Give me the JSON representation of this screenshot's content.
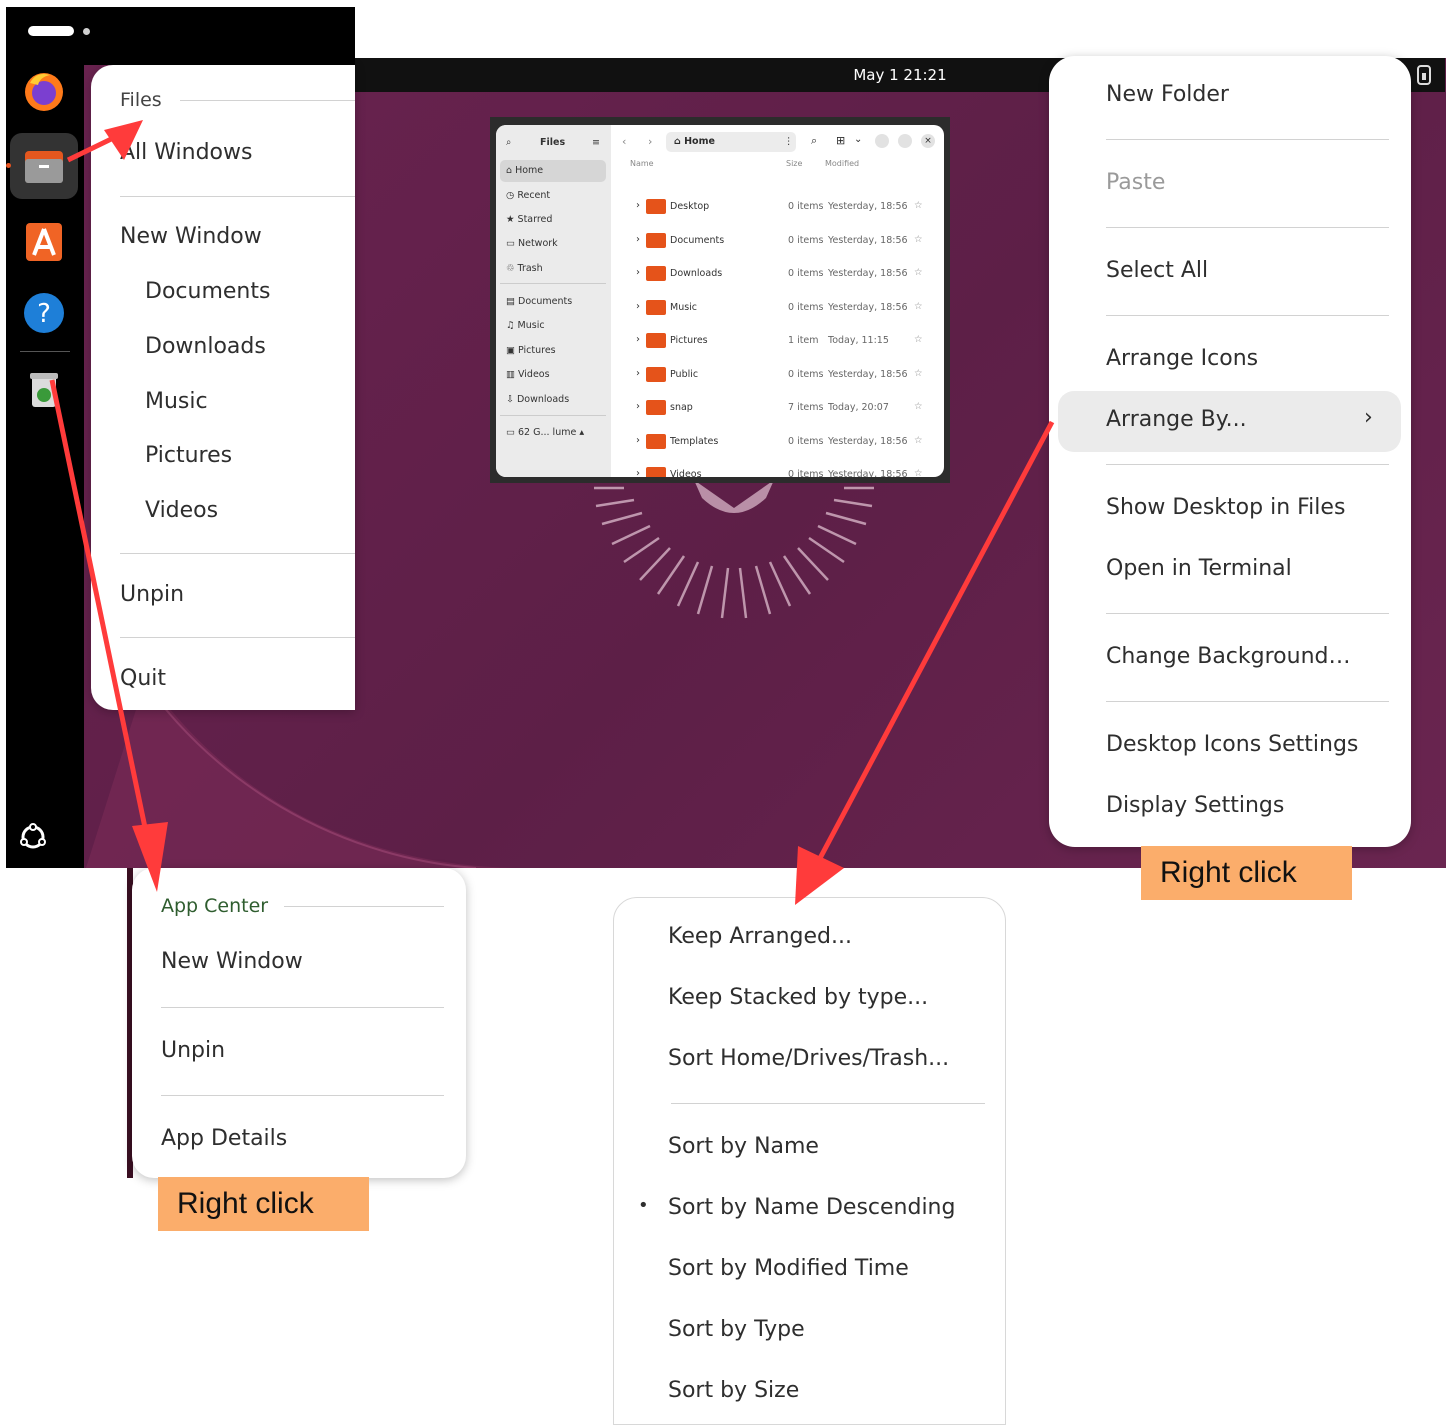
{
  "topbar": {
    "clock": "May 1  21:21"
  },
  "files_menu": {
    "header": "Files",
    "all_windows": "All Windows",
    "new_window": "New Window",
    "places": [
      "Documents",
      "Downloads",
      "Music",
      "Pictures",
      "Videos"
    ],
    "unpin": "Unpin",
    "quit": "Quit"
  },
  "appcenter_menu": {
    "header": "App Center",
    "new_window": "New Window",
    "unpin": "Unpin",
    "app_details": "App Details"
  },
  "desktop_menu": {
    "new_folder": "New Folder",
    "paste": "Paste",
    "select_all": "Select All",
    "arrange_icons": "Arrange Icons",
    "arrange_by": "Arrange By...",
    "show_desktop": "Show Desktop in Files",
    "open_terminal": "Open in Terminal",
    "change_background": "Change Background…",
    "desktop_icons_settings": "Desktop Icons Settings",
    "display_settings": "Display Settings"
  },
  "arrange_submenu": {
    "items_top": [
      "Keep Arranged...",
      "Keep Stacked by type...",
      "Sort Home/Drives/Trash..."
    ],
    "items_sort": [
      "Sort by Name",
      "Sort by Name Descending",
      "Sort by Modified Time",
      "Sort by Type",
      "Sort by Size"
    ],
    "selected": "Sort by Name Descending"
  },
  "callouts": {
    "right_click_1": "Right click",
    "right_click_2": "Right click"
  },
  "files_window": {
    "title": "Files",
    "path": "Home",
    "col_name": "Name",
    "col_size": "Size",
    "col_modified": "Modified",
    "sidebar": [
      "Home",
      "Recent",
      "Starred",
      "Network",
      "Trash",
      "Documents",
      "Music",
      "Pictures",
      "Videos",
      "Downloads"
    ],
    "volume": "62 G... lume",
    "rows": [
      {
        "name": "Desktop",
        "size": "0 items",
        "modified": "Yesterday, 18:56"
      },
      {
        "name": "Documents",
        "size": "0 items",
        "modified": "Yesterday, 18:56"
      },
      {
        "name": "Downloads",
        "size": "0 items",
        "modified": "Yesterday, 18:56"
      },
      {
        "name": "Music",
        "size": "0 items",
        "modified": "Yesterday, 18:56"
      },
      {
        "name": "Pictures",
        "size": "1 item",
        "modified": "Today, 11:15"
      },
      {
        "name": "Public",
        "size": "0 items",
        "modified": "Yesterday, 18:56"
      },
      {
        "name": "snap",
        "size": "7 items",
        "modified": "Today, 20:07"
      },
      {
        "name": "Templates",
        "size": "0 items",
        "modified": "Yesterday, 18:56"
      },
      {
        "name": "Videos",
        "size": "0 items",
        "modified": "Yesterday, 18:56"
      }
    ]
  },
  "colors": {
    "desktop": "#6a2350",
    "accent_orange": "#e5531a",
    "callout": "#fbad6b",
    "arrow": "#ff3b3b"
  },
  "dock_icons": [
    "firefox-icon",
    "files-icon",
    "app-center-icon",
    "help-icon",
    "trash-icon",
    "show-apps-icon"
  ]
}
